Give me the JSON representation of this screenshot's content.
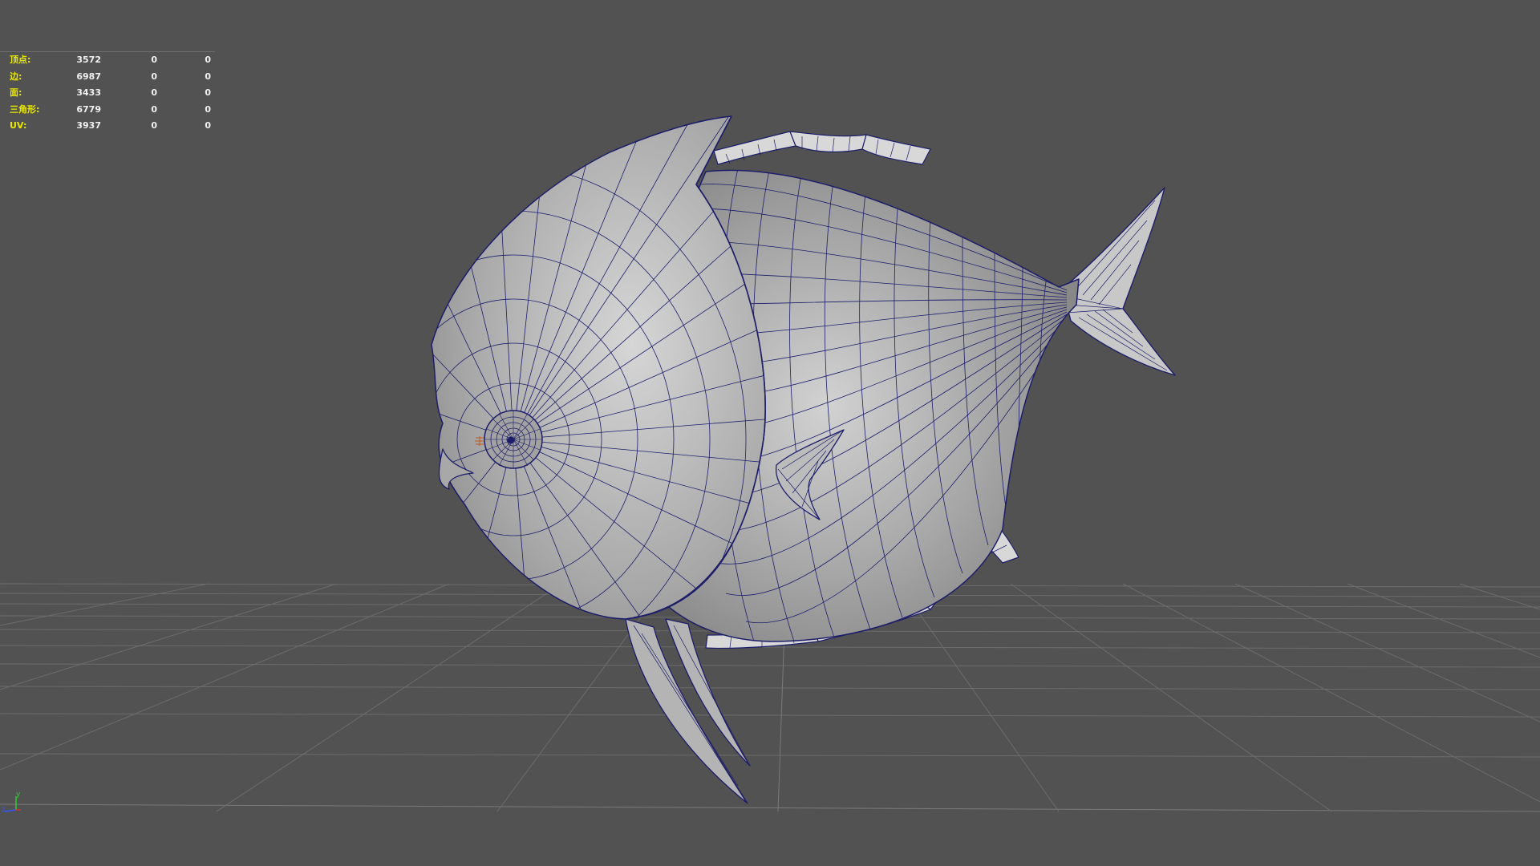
{
  "viewport": {
    "background": "#525252",
    "wire_color": "#1c1e6a",
    "grid_color": "#6a6a6a"
  },
  "hud": {
    "rows": [
      {
        "label": "顶点:",
        "total": "3572",
        "selected": "0",
        "extra": "0"
      },
      {
        "label": "边:",
        "total": "6987",
        "selected": "0",
        "extra": "0"
      },
      {
        "label": "面:",
        "total": "3433",
        "selected": "0",
        "extra": "0"
      },
      {
        "label": "三角形:",
        "total": "6779",
        "selected": "0",
        "extra": "0"
      },
      {
        "label": "UV:",
        "total": "3937",
        "selected": "0",
        "extra": "0"
      }
    ]
  },
  "axis_indicator": {
    "y": "y",
    "z": "z"
  }
}
